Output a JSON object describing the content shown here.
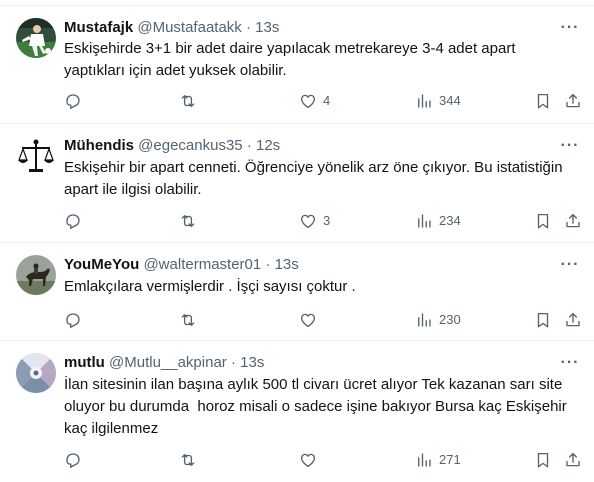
{
  "tweets": [
    {
      "name": "Mustafajk",
      "handle": "@Mustafaatakk",
      "time": "13s",
      "text": "Eskişehirde 3+1 bir adet daire yapılacak metrekareye 3-4 adet apart\nyaptıkları için adet yuksek olabilir.",
      "replies": "",
      "retweets": "",
      "likes": "4",
      "views": "344",
      "avatar": "soccer-player-photo"
    },
    {
      "name": "Mühendis",
      "handle": "@egecankus35",
      "time": "12s",
      "text": "Eskişehir bir apart cenneti. Öğrenciye yönelik arz öne çıkıyor. Bu istatistiğin\napart ile ilgisi olabilir.",
      "replies": "",
      "retweets": "",
      "likes": "3",
      "views": "234",
      "avatar": "scales-of-justice-logo"
    },
    {
      "name": "YouMeYou",
      "handle": "@waltermaster01",
      "time": "13s",
      "text": "Emlakçılara vermişlerdir . İşçi sayısı çoktur .",
      "replies": "",
      "retweets": "",
      "likes": "",
      "views": "230",
      "avatar": "horse-rider-photo"
    },
    {
      "name": "mutlu",
      "handle": "@Mutlu__akpinar",
      "time": "13s",
      "text": "İlan sitesinin ilan başına aylık 500 tl civarı ücret alıyor Tek kazanan sarı site\noluyor bu durumda  horoz misali o sadece işine bakıyor Bursa kaç Eskişehir\nkaç ilgilenmez",
      "replies": "",
      "retweets": "",
      "likes": "",
      "views": "271",
      "avatar": "mosaic-pattern-photo"
    }
  ],
  "ui": {
    "separator": "·",
    "more": "···"
  },
  "colors": {
    "text": "#0f1419",
    "secondary": "#536471",
    "divider": "#eff3f4"
  }
}
